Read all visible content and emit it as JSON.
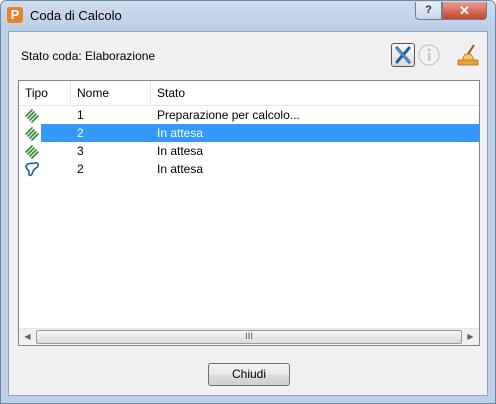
{
  "window": {
    "title": "Coda di Calcolo"
  },
  "titlebar": {
    "help_label": "?",
    "close_label": "✕"
  },
  "status": {
    "text": "Stato coda: Elaborazione"
  },
  "table": {
    "columns": [
      "Tipo",
      "Nome",
      "Stato"
    ],
    "rows": [
      {
        "type_icon": "toolpath-icon",
        "name": "1",
        "state": "Preparazione per calcolo...",
        "selected": false
      },
      {
        "type_icon": "toolpath-icon",
        "name": "2",
        "state": "In attesa",
        "selected": true
      },
      {
        "type_icon": "toolpath-icon",
        "name": "3",
        "state": "In attesa",
        "selected": false
      },
      {
        "type_icon": "boundary-icon",
        "name": "2",
        "state": "In attesa",
        "selected": false
      }
    ]
  },
  "scrollbar": {
    "thumb_grip": "III"
  },
  "footer": {
    "close_label": "Chiudi"
  },
  "colors": {
    "selection": "#3399ff",
    "toolpath_icon": "#2e8b2e",
    "boundary_icon": "#1b5fa8"
  }
}
